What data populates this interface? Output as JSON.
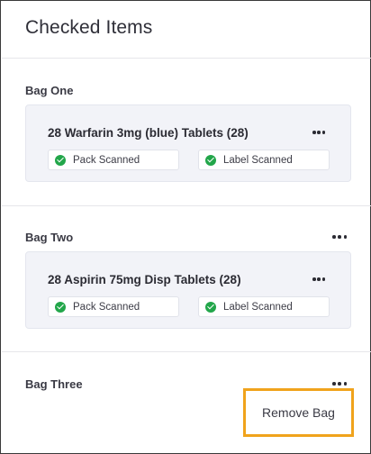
{
  "panel": {
    "title": "Checked Items"
  },
  "bags": [
    {
      "label": "Bag One",
      "item": {
        "title": "28 Warfarin 3mg (blue) Tablets (28)",
        "pack_status": "Pack Scanned",
        "label_status": "Label Scanned"
      }
    },
    {
      "label": "Bag Two",
      "item": {
        "title": "28 Aspirin 75mg Disp Tablets (28)",
        "pack_status": "Pack Scanned",
        "label_status": "Label Scanned"
      }
    },
    {
      "label": "Bag Three"
    }
  ],
  "menu": {
    "remove_bag": "Remove Bag"
  },
  "colors": {
    "status_green": "#22a64a",
    "highlight": "#f0a31c",
    "card_bg": "#f2f3f8"
  },
  "icons": {
    "more": "more-horizontal-icon",
    "check": "check-circle-icon"
  }
}
